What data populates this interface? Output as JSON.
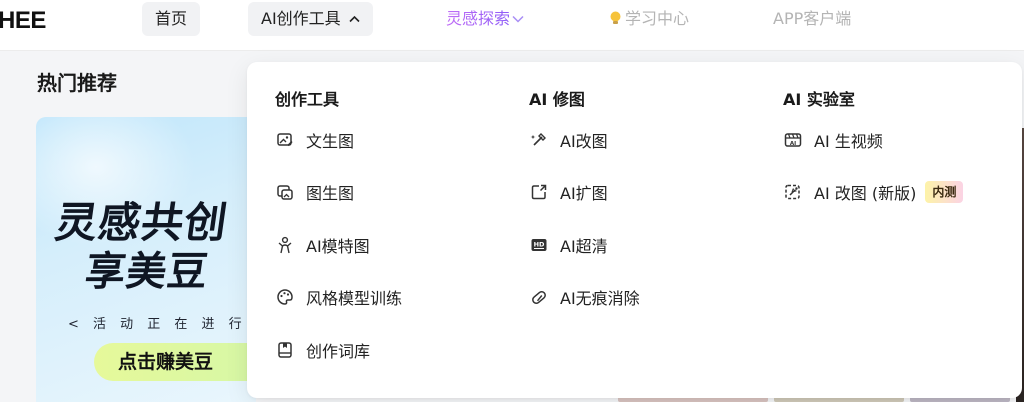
{
  "header": {
    "logo": "HEE",
    "nav": {
      "home": "首页",
      "ai_tools": "AI创作工具",
      "inspire": "灵感探索",
      "learn": "学习中心",
      "app": "APP客户端"
    }
  },
  "main": {
    "section_title": "热门推荐",
    "banner": {
      "line1": "灵感共创",
      "line2": "享美豆",
      "sub": "< 活 动 正 在 进 行 中",
      "button": "点击赚美豆"
    }
  },
  "dropdown": {
    "columns": [
      {
        "title": "创作工具",
        "items": [
          {
            "label": "文生图",
            "icon": "text-to-image-icon"
          },
          {
            "label": "图生图",
            "icon": "image-to-image-icon"
          },
          {
            "label": "AI模特图",
            "icon": "model-figure-icon"
          },
          {
            "label": "风格模型训练",
            "icon": "palette-icon"
          },
          {
            "label": "创作词库",
            "icon": "word-book-icon"
          }
        ]
      },
      {
        "title": "AI 修图",
        "items": [
          {
            "label": "AI改图",
            "icon": "magic-brush-icon"
          },
          {
            "label": "AI扩图",
            "icon": "expand-image-icon"
          },
          {
            "label": "AI超清",
            "icon": "hd-ultra-icon"
          },
          {
            "label": "AI无痕消除",
            "icon": "eraser-icon"
          }
        ]
      },
      {
        "title": "AI 实验室",
        "items": [
          {
            "label": "AI 生视频",
            "icon": "ai-video-icon"
          },
          {
            "label": "AI 改图 (新版)",
            "icon": "ai-edit-new-icon",
            "badge": "内测"
          }
        ]
      }
    ]
  },
  "colors": {
    "accent_inspire": "#b45ef0",
    "badge_from": "#fdf3a8",
    "badge_to": "#fbd3e4",
    "button_green": "#e6f99a"
  }
}
